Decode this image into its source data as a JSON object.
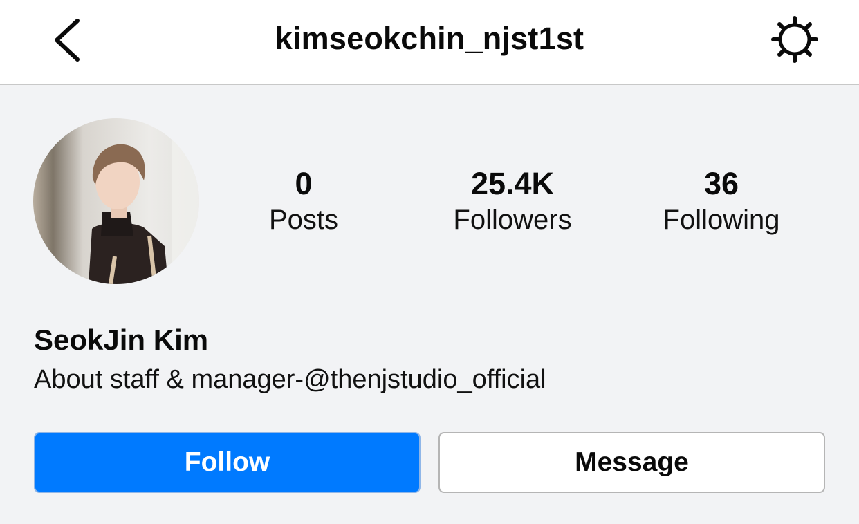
{
  "header": {
    "username": "kimseokchin_njst1st",
    "back_icon": "chevron-left-icon",
    "settings_icon": "gear-icon"
  },
  "profile": {
    "avatar": "profile-photo",
    "stats": [
      {
        "value": "0",
        "label": "Posts"
      },
      {
        "value": "25.4K",
        "label": "Followers"
      },
      {
        "value": "36",
        "label": "Following"
      }
    ],
    "name": "SeokJin Kim",
    "bio": "About staff & manager-@thenjstudio_official"
  },
  "actions": {
    "follow_label": "Follow",
    "message_label": "Message"
  },
  "colors": {
    "accent": "#007aff",
    "background": "#f2f3f5",
    "header_bg": "#ffffff"
  }
}
